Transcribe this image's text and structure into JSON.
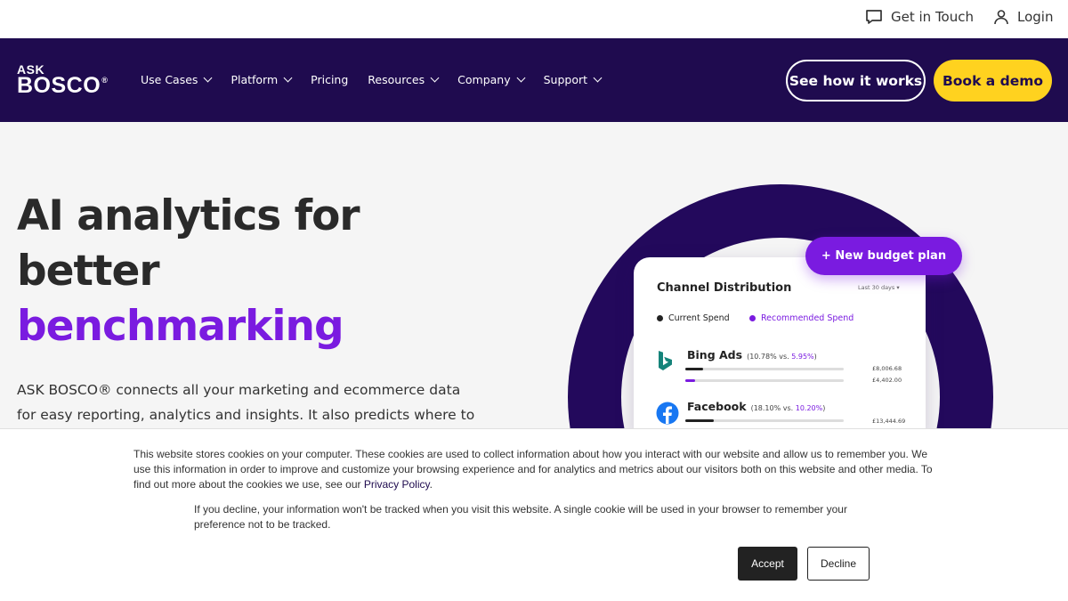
{
  "topbar": {
    "get_in_touch": "Get in Touch",
    "login": "Login",
    "chat_icon": "chat-bubble-icon",
    "user_icon": "user-icon"
  },
  "nav": {
    "logo_line1": "ASK",
    "logo_line2": "BOSCO",
    "logo_reg": "®",
    "menu": [
      {
        "label": "Use Cases",
        "has_dropdown": true
      },
      {
        "label": "Platform",
        "has_dropdown": true
      },
      {
        "label": "Pricing",
        "has_dropdown": false
      },
      {
        "label": "Resources",
        "has_dropdown": true
      },
      {
        "label": "Company",
        "has_dropdown": true
      },
      {
        "label": "Support",
        "has_dropdown": true
      }
    ],
    "cta_outline": "See how it works",
    "cta_primary": "Book a demo"
  },
  "hero": {
    "title_line1": "AI analytics for",
    "title_line2": "better",
    "title_accent": "benchmarking",
    "body": "ASK BOSCO® connects all your marketing and ecommerce data for easy reporting, analytics and insights. It also predicts where to"
  },
  "illustration": {
    "pill_label": "+ New budget plan",
    "card_title": "Channel Distribution",
    "range": "Last 30 days ▾",
    "legend": [
      {
        "label": "Current Spend",
        "color": "#222222"
      },
      {
        "label": "Recommended Spend",
        "color": "#7a1be0"
      }
    ],
    "channels": [
      {
        "name": "Bing Ads",
        "pct_prefix": "(10.78% vs. ",
        "pct_hl": "5.95%",
        "pct_suffix": ")",
        "amount1": "£8,006.68",
        "amount2": "£4,402.00",
        "current_fill": 0.11,
        "recommended_fill": 0.06,
        "icon": "bing-icon"
      },
      {
        "name": "Facebook",
        "pct_prefix": "(18.10% vs. ",
        "pct_hl": "10.20%",
        "pct_suffix": ")",
        "amount1": "£13,444.69",
        "current_fill": 0.18,
        "icon": "facebook-icon"
      }
    ]
  },
  "cookie": {
    "text1": "This website stores cookies on your computer. These cookies are used to collect information about how you interact with our website and allow us to remember you. We use this information in order to improve and customize your browsing experience and for analytics and metrics about our visitors both on this website and other media. To find out more about the cookies we use, see our ",
    "privacy_link": "Privacy Policy",
    "text1_end": ".",
    "text2": "If you decline, your information won't be tracked when you visit this website. A single cookie will be used in your browser to remember your preference not to be tracked.",
    "accept": "Accept",
    "decline": "Decline"
  },
  "colors": {
    "nav_bg": "#1f0b4f",
    "accent_purple": "#7a1be0",
    "cta_yellow": "#ffd21f"
  }
}
